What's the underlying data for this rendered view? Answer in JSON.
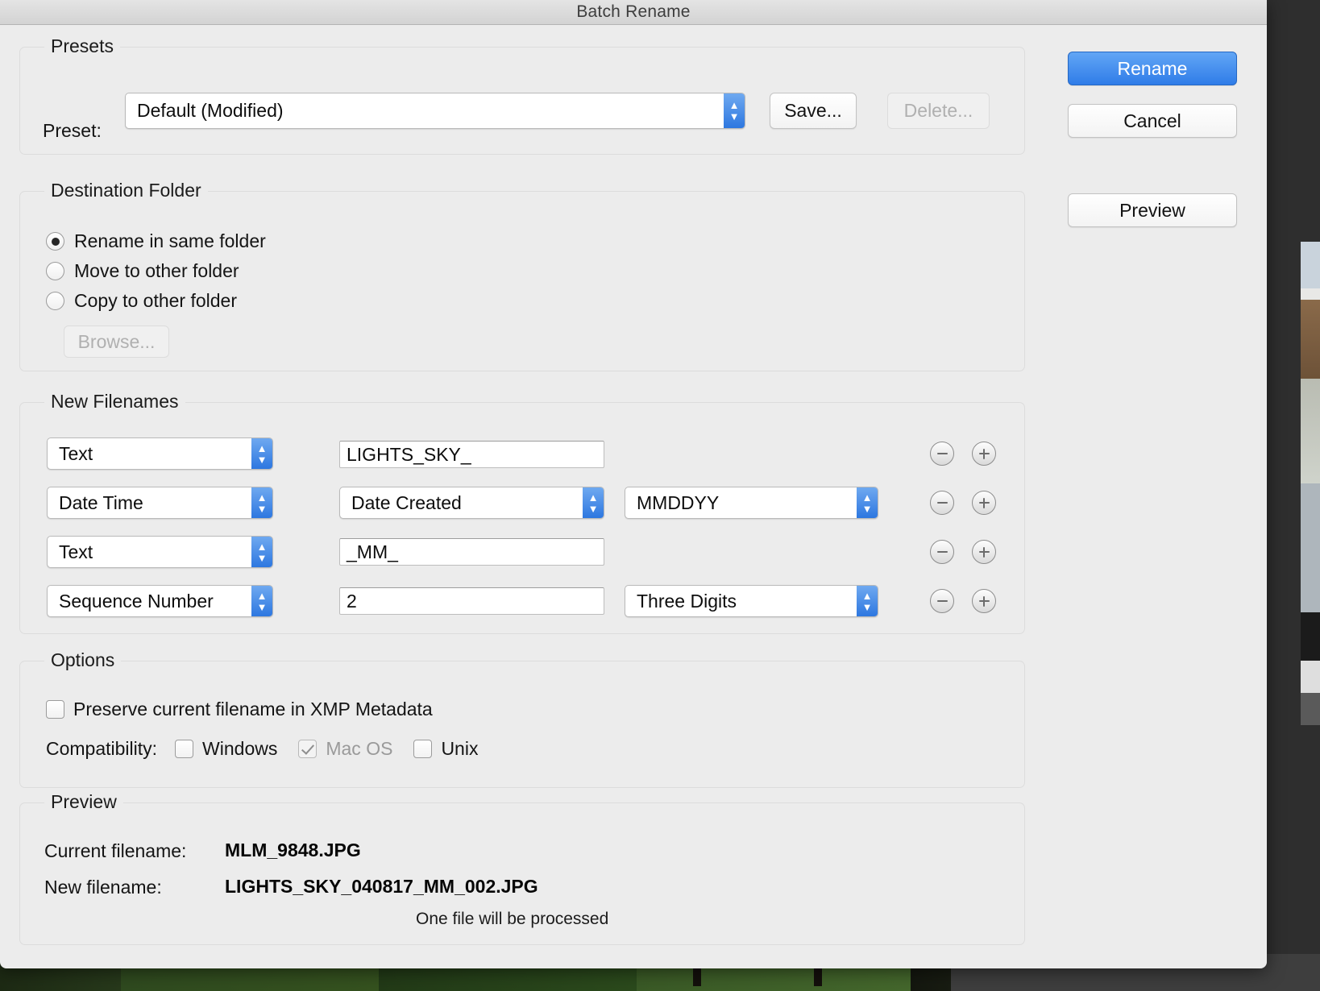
{
  "window": {
    "title": "Batch Rename"
  },
  "actions": {
    "rename_label": "Rename",
    "cancel_label": "Cancel",
    "preview_label": "Preview"
  },
  "presets": {
    "group_title": "Presets",
    "preset_label": "Preset:",
    "preset_value": "Default (Modified)",
    "save_label": "Save...",
    "delete_label": "Delete..."
  },
  "destination": {
    "group_title": "Destination Folder",
    "options": [
      {
        "label": "Rename in same folder",
        "selected": true
      },
      {
        "label": "Move to other folder",
        "selected": false
      },
      {
        "label": "Copy to other folder",
        "selected": false
      }
    ],
    "browse_label": "Browse..."
  },
  "new_filenames": {
    "group_title": "New Filenames",
    "rows": [
      {
        "type": "Text",
        "value": "LIGHTS_SKY_",
        "value_kind": "text",
        "format": null
      },
      {
        "type": "Date Time",
        "value": "Date Created",
        "value_kind": "popup",
        "format": "MMDDYY"
      },
      {
        "type": "Text",
        "value": "_MM_",
        "value_kind": "text",
        "format": null
      },
      {
        "type": "Sequence Number",
        "value": "2",
        "value_kind": "text",
        "format": "Three Digits"
      }
    ],
    "remove_icon": "minus-circle-icon",
    "add_icon": "plus-circle-icon"
  },
  "options": {
    "group_title": "Options",
    "preserve_label": "Preserve current filename in XMP Metadata",
    "preserve_checked": false,
    "compatibility_label": "Compatibility:",
    "compatibility": [
      {
        "label": "Windows",
        "checked": false,
        "disabled": false
      },
      {
        "label": "Mac OS",
        "checked": true,
        "disabled": true
      },
      {
        "label": "Unix",
        "checked": false,
        "disabled": false
      }
    ]
  },
  "preview": {
    "group_title": "Preview",
    "current_label": "Current filename:",
    "current_value": "MLM_9848.JPG",
    "new_label": "New filename:",
    "new_value": "LIGHTS_SKY_040817_MM_002.JPG",
    "note": "One file will be processed"
  },
  "colors": {
    "accent": "#2f7ce8",
    "window_bg": "#ececec",
    "titlebar_bg": "#dcdcdc"
  }
}
